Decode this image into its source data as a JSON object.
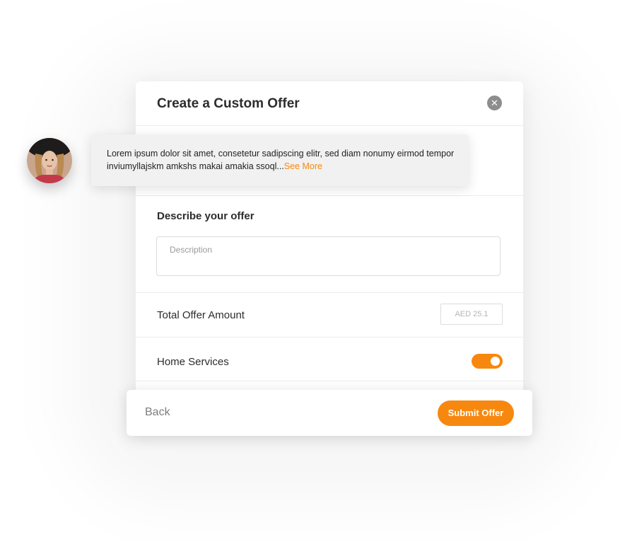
{
  "dialog": {
    "title": "Create a Custom Offer",
    "description_section_label": "Describe your offer",
    "description_placeholder": "Description",
    "total_offer_label": "Total Offer Amount",
    "amount_value": "AED 25.1",
    "home_services_label": "Home Services",
    "home_services_enabled": true
  },
  "tooltip": {
    "message": "Lorem ipsum dolor sit amet, consetetur sadipscing elitr, sed diam nonumy eirmod tempor inviumyllajskm amkshs makai amakia ssoql...",
    "see_more": "See More"
  },
  "footer": {
    "back_label": "Back",
    "submit_label": "Submit Offer"
  },
  "icons": {
    "close": "close-icon",
    "avatar": "user-avatar"
  },
  "colors": {
    "accent": "#f7880f",
    "close_icon": "#8d8d8d"
  }
}
